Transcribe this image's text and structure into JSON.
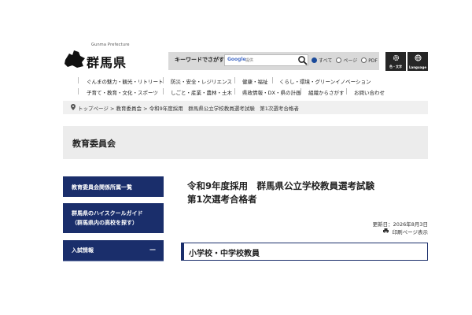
{
  "header": {
    "logo_en": "Gunma Prefecture",
    "logo_text": "群馬県",
    "search": {
      "label": "キーワードでさがす",
      "provider": "Google",
      "placeholder": "提供",
      "options": [
        "すべて",
        "ページ",
        "PDF"
      ],
      "selected": "すべて"
    },
    "tools": [
      {
        "label": "色・文字",
        "icon": "gear-icon"
      },
      {
        "label": "Language",
        "icon": "globe-icon"
      }
    ]
  },
  "nav": {
    "row1": [
      "ぐんまの魅力・観光・リトリート",
      "防災・安全・レジリエンス",
      "健康・福祉",
      "くらし・環境・グリーンイノベーション"
    ],
    "row2": [
      "子育て・教育・文化・スポーツ",
      "しごと・産業・農林・土木",
      "県政情報・DX・県の計画",
      "組織からさがす",
      "お問い合わせ"
    ]
  },
  "breadcrumb": {
    "icon": "location-pin-icon",
    "items": [
      "トップページ",
      "教育委員会",
      "令和9年度採用　群馬県公立学校教員選考試験　第1次選考合格者"
    ],
    "separator": ">"
  },
  "banner": {
    "title": "教育委員会"
  },
  "sidebar": {
    "items": [
      {
        "label": "教育委員会関係所属一覧"
      },
      {
        "label_line1": "群馬県のハイスクールガイド",
        "label_line2": "（群馬県内の高校を探す）"
      },
      {
        "label": "入試情報",
        "toggle": "—"
      }
    ]
  },
  "main": {
    "title_line1": "令和9年度採用　群馬県公立学校教員選考試験",
    "title_line2": "第1次選考合格者",
    "updated": "更新日：2026年8月3日",
    "print": "印刷ページ表示",
    "section_heading": "小学校・中学校教員"
  },
  "colors": {
    "navy": "#1a2e6b",
    "tool_bg": "#262626",
    "search_bg": "#d9d9d9",
    "banner_bg": "#ececec"
  }
}
